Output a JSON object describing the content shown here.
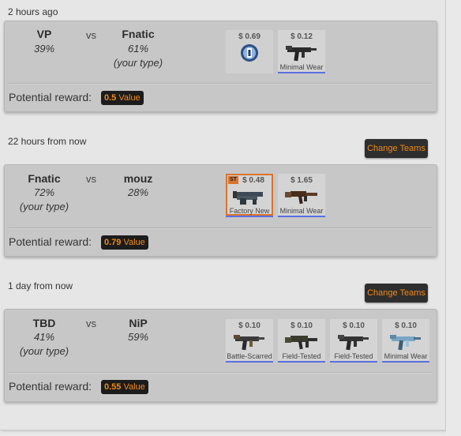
{
  "colors": {
    "accent": "#f08a1a",
    "wear_underline": "#5b6fe0",
    "stattrak": "#d8742e"
  },
  "reward_label": "Potential reward:",
  "matches": [
    {
      "time": "2 hours ago",
      "change_button": "",
      "team1": {
        "name": "VP",
        "pct": "39%",
        "note": ""
      },
      "vs": "vs",
      "team2": {
        "name": "Fnatic",
        "pct": "61%",
        "note": "(your type)"
      },
      "reward_value": "0.5",
      "reward_unit": "Value",
      "items": [
        {
          "price": "$ 0.69",
          "wear": "",
          "icon": "sticker-capsule-icon",
          "stattrak": false
        },
        {
          "price": "$ 0.12",
          "wear": "Minimal Wear",
          "icon": "smg-icon",
          "stattrak": false
        }
      ]
    },
    {
      "time": "22 hours from now",
      "change_button": "Change Teams",
      "team1": {
        "name": "Fnatic",
        "pct": "72%",
        "note": "(your type)"
      },
      "vs": "vs",
      "team2": {
        "name": "mouz",
        "pct": "28%",
        "note": ""
      },
      "reward_value": "0.79",
      "reward_unit": "Value",
      "items": [
        {
          "price": "$ 0.48",
          "wear": "Factory New",
          "icon": "shotgun-icon",
          "stattrak": true,
          "stattrak_label": "ST"
        },
        {
          "price": "$ 1.65",
          "wear": "Minimal Wear",
          "icon": "rifle-icon",
          "stattrak": false
        }
      ]
    },
    {
      "time": "1 day from now",
      "change_button": "Change Teams",
      "team1": {
        "name": "TBD",
        "pct": "41%",
        "note": "(your type)"
      },
      "vs": "vs",
      "team2": {
        "name": "NiP",
        "pct": "59%",
        "note": ""
      },
      "reward_value": "0.55",
      "reward_unit": "Value",
      "items": [
        {
          "price": "$ 0.10",
          "wear": "Battle-Scarred",
          "icon": "smg-icon",
          "stattrak": false
        },
        {
          "price": "$ 0.10",
          "wear": "Field-Tested",
          "icon": "rifle-icon",
          "stattrak": false
        },
        {
          "price": "$ 0.10",
          "wear": "Field-Tested",
          "icon": "smg-icon",
          "stattrak": false
        },
        {
          "price": "$ 0.10",
          "wear": "Minimal Wear",
          "icon": "smg-icon",
          "stattrak": false
        }
      ]
    }
  ]
}
